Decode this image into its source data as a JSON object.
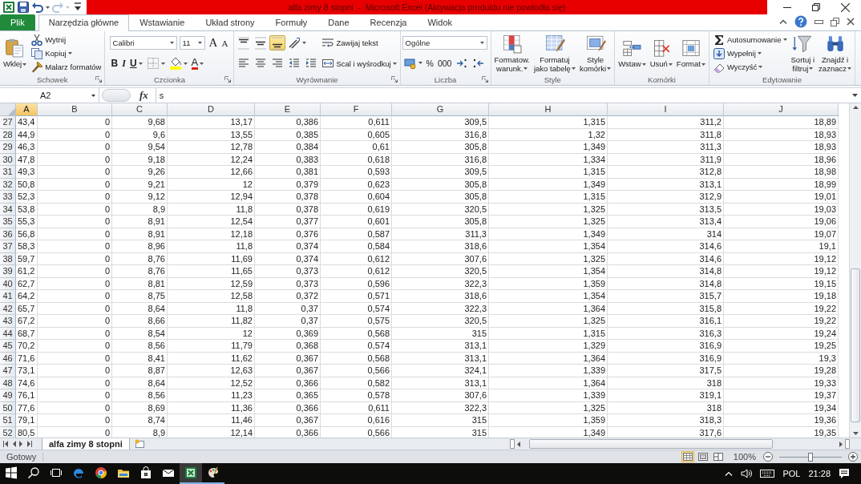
{
  "title_bar": {
    "title": "alfa zimy 8 stopni  -  Microsoft Excel (Aktywacja produktu nie powiodła się)",
    "quick_access": [
      {
        "kind": "logo",
        "disabled": false,
        "dropdown": false
      },
      {
        "kind": "save",
        "disabled": false,
        "dropdown": false
      },
      {
        "kind": "undo",
        "disabled": false,
        "dropdown": true
      },
      {
        "kind": "redo",
        "disabled": true,
        "dropdown": true
      },
      {
        "kind": "customize",
        "disabled": false,
        "dropdown": false
      }
    ]
  },
  "ribbon_tabs": [
    {
      "label": "Plik",
      "kind": "file",
      "selected": false
    },
    {
      "label": "Narzędzia główne",
      "kind": "tab",
      "selected": true
    },
    {
      "label": "Wstawianie",
      "kind": "tab",
      "selected": false
    },
    {
      "label": "Układ strony",
      "kind": "tab",
      "selected": false
    },
    {
      "label": "Formuły",
      "kind": "tab",
      "selected": false
    },
    {
      "label": "Dane",
      "kind": "tab",
      "selected": false
    },
    {
      "label": "Recenzja",
      "kind": "tab",
      "selected": false
    },
    {
      "label": "Widok",
      "kind": "tab",
      "selected": false
    }
  ],
  "ribbon": {
    "groups": [
      {
        "label": "Schowek",
        "launcher": true,
        "stacks": [
          [
            [
              {
                "kind": "large",
                "label": "Wklej",
                "dropdown": true
              }
            ]
          ],
          [
            [
              {
                "kind": "small",
                "label": "Wytnij",
                "dropdown": false
              }
            ],
            [
              {
                "kind": "small",
                "label": "Kopiuj",
                "dropdown": true
              }
            ],
            [
              {
                "kind": "small",
                "label": "Malarz formatów",
                "dropdown": false
              }
            ]
          ]
        ]
      },
      {
        "label": "Czcionka",
        "launcher": true,
        "stacks": [
          [
            [
              {
                "kind": "field",
                "label": "Calibri",
                "dropdown": true
              },
              {
                "kind": "field",
                "label": "11",
                "dropdown": true
              },
              {
                "kind": "grow",
                "label": "A",
                "dropdown": false
              },
              {
                "kind": "shrink",
                "label": "A",
                "dropdown": false
              }
            ],
            [
              {
                "kind": "bold_toggle",
                "label": "B",
                "on": false,
                "dropdown": false
              },
              {
                "kind": "italic_toggle",
                "label": "I",
                "on": false,
                "dropdown": false
              },
              {
                "kind": "underline_toggle",
                "label": "U",
                "on": false,
                "dropdown": true
              },
              {
                "kind": "icon",
                "dropdown": true
              },
              {
                "kind": "icon",
                "dropdown": true
              },
              {
                "kind": "colorglyph",
                "label": "A",
                "dropdown": true
              }
            ]
          ]
        ]
      },
      {
        "label": "Wyrównanie",
        "launcher": true,
        "stacks": [
          [
            [
              {
                "kind": "icon",
                "on": false,
                "dropdown": false
              },
              {
                "kind": "icon",
                "on": false,
                "dropdown": false
              },
              {
                "kind": "icon",
                "on": true,
                "dropdown": false
              },
              {
                "kind": "icon",
                "dropdown": true
              }
            ],
            [
              {
                "kind": "icon",
                "on": false,
                "dropdown": false
              },
              {
                "kind": "icon",
                "on": false,
                "dropdown": false
              },
              {
                "kind": "icon",
                "on": false,
                "dropdown": false
              },
              {
                "kind": "icon",
                "dropdown": false
              },
              {
                "kind": "icon",
                "dropdown": false
              }
            ]
          ],
          [
            [
              {
                "kind": "small",
                "label": "Zawijaj tekst",
                "dropdown": false
              }
            ],
            [
              {
                "kind": "small",
                "label": "Scal i wyśrodkuj",
                "dropdown": true
              }
            ]
          ]
        ]
      },
      {
        "label": "Liczba",
        "launcher": true,
        "stacks": [
          [
            [
              {
                "kind": "field",
                "label": "Ogólne",
                "dropdown": true
              }
            ],
            [
              {
                "kind": "icon",
                "dropdown": true
              },
              {
                "kind": "glyph",
                "label": "%",
                "dropdown": false
              },
              {
                "kind": "glyph",
                "label": "000",
                "dropdown": false
              },
              {
                "kind": "icon",
                "dropdown": false
              },
              {
                "kind": "icon",
                "dropdown": false
              }
            ]
          ]
        ]
      },
      {
        "label": "Style",
        "launcher": false,
        "stacks": [
          [
            [
              {
                "kind": "large",
                "label": "Formatow.\nwarunk.",
                "dropdown": true
              }
            ]
          ],
          [
            [
              {
                "kind": "large",
                "label": "Formatuj\njako tabelę",
                "dropdown": true
              }
            ]
          ],
          [
            [
              {
                "kind": "large",
                "label": "Style\nkomórki",
                "dropdown": true
              }
            ]
          ]
        ]
      },
      {
        "label": "Komórki",
        "launcher": false,
        "stacks": [
          [
            [
              {
                "kind": "large",
                "label": "Wstaw",
                "dropdown": true
              }
            ]
          ],
          [
            [
              {
                "kind": "large",
                "label": "Usuń",
                "dropdown": true
              }
            ]
          ],
          [
            [
              {
                "kind": "large",
                "label": "Format",
                "dropdown": true
              }
            ]
          ]
        ]
      },
      {
        "label": "Edytowanie",
        "launcher": false,
        "stacks": [
          [
            [
              {
                "kind": "small",
                "label": "Autosumowanie",
                "dropdown": true
              }
            ],
            [
              {
                "kind": "small",
                "label": "Wypełnij",
                "dropdown": true
              }
            ],
            [
              {
                "kind": "small",
                "label": "Wyczyść",
                "dropdown": true
              }
            ]
          ],
          [
            [
              {
                "kind": "large",
                "label": "Sortuj i\nfiltruj",
                "dropdown": true
              }
            ]
          ],
          [
            [
              {
                "kind": "large",
                "label": "Znajdź i\nzaznacz",
                "dropdown": true
              }
            ]
          ]
        ]
      }
    ]
  },
  "formula_bar": {
    "name_box": "A2",
    "function_label": "fx",
    "value": "s"
  },
  "sheet": {
    "columns": [
      {
        "label": "A",
        "selected": true
      },
      {
        "label": "B",
        "selected": false
      },
      {
        "label": "C",
        "selected": false
      },
      {
        "label": "D",
        "selected": false
      },
      {
        "label": "E",
        "selected": false
      },
      {
        "label": "F",
        "selected": false
      },
      {
        "label": "G",
        "selected": false
      },
      {
        "label": "H",
        "selected": false
      },
      {
        "label": "I",
        "selected": false
      },
      {
        "label": "J",
        "selected": false
      }
    ],
    "rows": [
      {
        "header": "27",
        "cells": [
          "43,4",
          "0",
          "9,68",
          "13,17",
          "0,386",
          "0,611",
          "309,5",
          "1,315",
          "311,2",
          "18,89"
        ]
      },
      {
        "header": "28",
        "cells": [
          "44,9",
          "0",
          "9,6",
          "13,55",
          "0,385",
          "0,605",
          "316,8",
          "1,32",
          "311,8",
          "18,93"
        ]
      },
      {
        "header": "29",
        "cells": [
          "46,3",
          "0",
          "9,54",
          "12,78",
          "0,384",
          "0,61",
          "305,8",
          "1,349",
          "311,3",
          "18,93"
        ]
      },
      {
        "header": "30",
        "cells": [
          "47,8",
          "0",
          "9,18",
          "12,24",
          "0,383",
          "0,618",
          "316,8",
          "1,334",
          "311,9",
          "18,96"
        ]
      },
      {
        "header": "31",
        "cells": [
          "49,3",
          "0",
          "9,26",
          "12,66",
          "0,381",
          "0,593",
          "309,5",
          "1,315",
          "312,8",
          "18,98"
        ]
      },
      {
        "header": "32",
        "cells": [
          "50,8",
          "0",
          "9,21",
          "12",
          "0,379",
          "0,623",
          "305,8",
          "1,349",
          "313,1",
          "18,99"
        ]
      },
      {
        "header": "33",
        "cells": [
          "52,3",
          "0",
          "9,12",
          "12,94",
          "0,378",
          "0,604",
          "305,8",
          "1,315",
          "312,9",
          "19,01"
        ]
      },
      {
        "header": "34",
        "cells": [
          "53,8",
          "0",
          "8,9",
          "11,8",
          "0,378",
          "0,619",
          "320,5",
          "1,325",
          "313,5",
          "19,03"
        ]
      },
      {
        "header": "35",
        "cells": [
          "55,3",
          "0",
          "8,91",
          "12,54",
          "0,377",
          "0,601",
          "305,8",
          "1,325",
          "313,4",
          "19,06"
        ]
      },
      {
        "header": "36",
        "cells": [
          "56,8",
          "0",
          "8,91",
          "12,18",
          "0,376",
          "0,587",
          "311,3",
          "1,349",
          "314",
          "19,07"
        ]
      },
      {
        "header": "37",
        "cells": [
          "58,3",
          "0",
          "8,96",
          "11,8",
          "0,374",
          "0,584",
          "318,6",
          "1,354",
          "314,6",
          "19,1"
        ]
      },
      {
        "header": "38",
        "cells": [
          "59,7",
          "0",
          "8,76",
          "11,69",
          "0,374",
          "0,612",
          "307,6",
          "1,325",
          "314,6",
          "19,12"
        ]
      },
      {
        "header": "39",
        "cells": [
          "61,2",
          "0",
          "8,76",
          "11,65",
          "0,373",
          "0,612",
          "320,5",
          "1,354",
          "314,8",
          "19,12"
        ]
      },
      {
        "header": "40",
        "cells": [
          "62,7",
          "0",
          "8,81",
          "12,59",
          "0,373",
          "0,596",
          "322,3",
          "1,359",
          "314,8",
          "19,15"
        ]
      },
      {
        "header": "41",
        "cells": [
          "64,2",
          "0",
          "8,75",
          "12,58",
          "0,372",
          "0,571",
          "318,6",
          "1,354",
          "315,7",
          "19,18"
        ]
      },
      {
        "header": "42",
        "cells": [
          "65,7",
          "0",
          "8,64",
          "11,8",
          "0,37",
          "0,574",
          "322,3",
          "1,364",
          "315,8",
          "19,22"
        ]
      },
      {
        "header": "43",
        "cells": [
          "67,2",
          "0",
          "8,66",
          "11,82",
          "0,37",
          "0,575",
          "320,5",
          "1,325",
          "316,1",
          "19,22"
        ]
      },
      {
        "header": "44",
        "cells": [
          "68,7",
          "0",
          "8,54",
          "12",
          "0,369",
          "0,568",
          "315",
          "1,315",
          "316,3",
          "19,24"
        ]
      },
      {
        "header": "45",
        "cells": [
          "70,2",
          "0",
          "8,56",
          "11,79",
          "0,368",
          "0,574",
          "313,1",
          "1,329",
          "316,9",
          "19,25"
        ]
      },
      {
        "header": "46",
        "cells": [
          "71,6",
          "0",
          "8,41",
          "11,62",
          "0,367",
          "0,568",
          "313,1",
          "1,364",
          "316,9",
          "19,3"
        ]
      },
      {
        "header": "47",
        "cells": [
          "73,1",
          "0",
          "8,87",
          "12,63",
          "0,367",
          "0,566",
          "324,1",
          "1,339",
          "317,5",
          "19,28"
        ]
      },
      {
        "header": "48",
        "cells": [
          "74,6",
          "0",
          "8,64",
          "12,52",
          "0,366",
          "0,582",
          "313,1",
          "1,364",
          "318",
          "19,33"
        ]
      },
      {
        "header": "49",
        "cells": [
          "76,1",
          "0",
          "8,56",
          "11,23",
          "0,365",
          "0,578",
          "307,6",
          "1,339",
          "319,1",
          "19,37"
        ]
      },
      {
        "header": "50",
        "cells": [
          "77,6",
          "0",
          "8,69",
          "11,36",
          "0,366",
          "0,611",
          "322,3",
          "1,325",
          "318",
          "19,34"
        ]
      },
      {
        "header": "51",
        "cells": [
          "79,1",
          "0",
          "8,74",
          "11,46",
          "0,367",
          "0,616",
          "315",
          "1,359",
          "318,3",
          "19,36"
        ]
      },
      {
        "header": "52",
        "cells": [
          "80,5",
          "0",
          "8,9",
          "12,14",
          "0,366",
          "0,566",
          "315",
          "1,349",
          "317,6",
          "19,35"
        ]
      }
    ]
  },
  "sheet_tabs": [
    {
      "label": "alfa zimy 8 stopni",
      "selected": true
    }
  ],
  "status_bar": {
    "text": "Gotowy",
    "views": [
      {
        "kind": "normal",
        "selected": true
      },
      {
        "kind": "page_layout",
        "selected": false
      },
      {
        "kind": "page_break",
        "selected": false
      }
    ],
    "zoom": "100%",
    "zoom_slider": {
      "level": 0.5
    }
  },
  "taskbar": {
    "apps": [
      {
        "kind": "start",
        "running": false,
        "active": false
      },
      {
        "kind": "search",
        "running": false,
        "active": false
      },
      {
        "kind": "task_view",
        "running": false,
        "active": false
      },
      {
        "kind": "edge",
        "running": false,
        "active": false
      },
      {
        "kind": "chrome",
        "running": false,
        "active": false
      },
      {
        "kind": "explorer",
        "running": false,
        "active": false
      },
      {
        "kind": "store",
        "running": false,
        "active": false
      },
      {
        "kind": "mail",
        "running": false,
        "active": false
      },
      {
        "kind": "excel",
        "running": true,
        "active": true
      },
      {
        "kind": "paint",
        "running": true,
        "active": false
      }
    ],
    "tray": {
      "language": "POL",
      "time": "21:28"
    }
  }
}
